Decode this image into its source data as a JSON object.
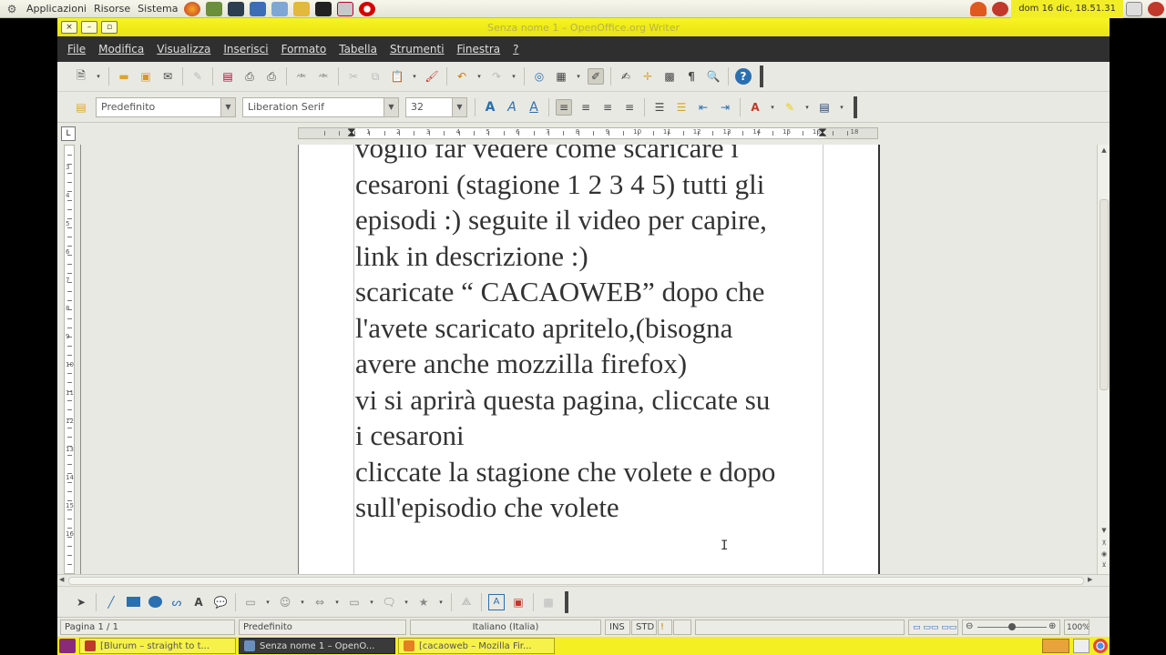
{
  "top_panel": {
    "menus": [
      "Applicazioni",
      "Risorse",
      "Sistema"
    ],
    "clock": "dom 16 dic, 18.51.31"
  },
  "window": {
    "title": "Senza nome 1 – OpenOffice.org Writer",
    "close_glyph": "×",
    "minimize_glyph": "–",
    "maximize_glyph": "▫"
  },
  "menubar": {
    "items": [
      {
        "label": "File",
        "key": "F",
        "rest": "ile"
      },
      {
        "label": "Modifica",
        "key": "M",
        "rest": "odifica"
      },
      {
        "label": "Visualizza",
        "key": "V",
        "rest": "isualizza"
      },
      {
        "label": "Inserisci",
        "key": "I",
        "rest": "nserisci"
      },
      {
        "label": "Formato",
        "key": "o",
        "pre": "F",
        "rest": "rmato"
      },
      {
        "label": "Tabella",
        "key": "T",
        "rest": "abella"
      },
      {
        "label": "Strumenti",
        "key": "S",
        "rest": "trumenti"
      },
      {
        "label": "Finestra",
        "key": "n",
        "pre": "Fi",
        "rest": "estra"
      },
      {
        "label": "?",
        "key": "?",
        "rest": ""
      }
    ]
  },
  "formatting": {
    "paragraph_style": "Predefinito",
    "font_name": "Liberation Serif",
    "font_size": "32"
  },
  "ruler": {
    "numbers": [
      "1",
      "2",
      "3",
      "4",
      "5",
      "6",
      "7",
      "8",
      "9",
      "10",
      "11",
      "12",
      "13",
      "14",
      "15",
      "16",
      "18"
    ],
    "vertical_numbers": [
      "3",
      "4",
      "5",
      "6",
      "7",
      "8",
      "9",
      "10",
      "11",
      "12",
      "13",
      "14",
      "15",
      "16"
    ]
  },
  "document": {
    "lines": [
      "voglio far vedere come scaricare i",
      "cesaroni (stagione 1 2 3 4 5) tutti gli",
      "episodi :) seguite il video per capire,",
      "link in descrizione :)",
      "scaricate “ CACAOWEB” dopo che",
      "l'avete scaricato apritelo,(bisogna",
      "avere anche mozzilla firefox)",
      "vi si aprirà questa pagina, cliccate su",
      "i cesaroni",
      "cliccate la stagione che volete e dopo",
      "sull'episodio che volete"
    ]
  },
  "statusbar": {
    "page": "Pagina 1 / 1",
    "page_style": "Predefinito",
    "language": "Italiano (Italia)",
    "insert_mode": "INS",
    "selection_mode": "STD",
    "zoom": "100%"
  },
  "taskbar": {
    "tasks": [
      {
        "label": "[Blurum – straight to t...",
        "color": "#c0392b"
      },
      {
        "label": "Senza nome 1 – OpenO...",
        "color": "#6a8fbf"
      },
      {
        "label": "[cacaoweb – Mozilla Fir...",
        "color": "#e67e22"
      }
    ]
  },
  "colors": {
    "panel_yellow": "#f2ee26",
    "menubar_dark": "#2f2f2f"
  }
}
